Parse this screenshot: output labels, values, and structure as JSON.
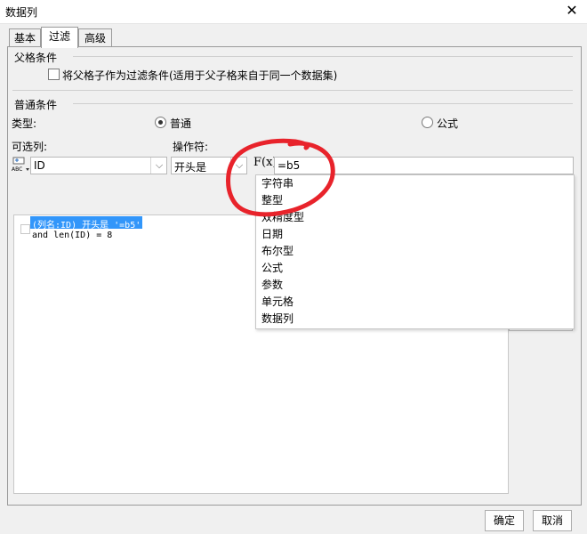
{
  "window": {
    "title": "数据列",
    "close_symbol": "✕"
  },
  "tabs": [
    {
      "label": "基本"
    },
    {
      "label": "过滤",
      "active": true
    },
    {
      "label": "高级"
    }
  ],
  "parent_condition": {
    "title": "父格条件",
    "checkbox_label": "将父格子作为过滤条件(适用于父子格来自于同一个数据集)",
    "checked": false
  },
  "normal_condition": {
    "title": "普通条件",
    "type_label": "类型:",
    "option_normal": "普通",
    "option_formula": "公式",
    "selected": "普通",
    "available_columns_label": "可选列:",
    "operator_label": "操作符:",
    "column_value": "ID",
    "operator_value": "开头是",
    "formula_icon_text": "F(x)",
    "formula_value": "=b5",
    "column_type_icon_text": "ABC"
  },
  "condition_list": [
    {
      "text": "(列名:ID) 开头是 '=b5'",
      "selected": true
    },
    {
      "text": "and len(ID) = 8",
      "selected": false
    }
  ],
  "type_menu": {
    "items": [
      "字符串",
      "整型",
      "双精度型",
      "日期",
      "布尔型",
      "公式",
      "参数",
      "单元格",
      "数据列"
    ]
  },
  "footer": {
    "ok_label": "确定",
    "cancel_label": "取消"
  },
  "annotation_color": "#e8232b"
}
